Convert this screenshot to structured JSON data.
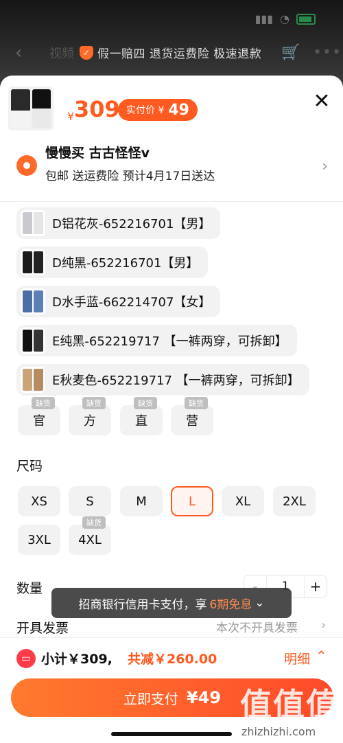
{
  "top_bar": {
    "back_icon": "chevron-left-icon",
    "tab_text": "视频",
    "guarantee": "假一赔四 退货运费险 极速退款",
    "shield_glyph": "✓",
    "cart_icon": "cart-icon",
    "more_icon": "more-icon"
  },
  "product": {
    "price_symbol": "¥",
    "price": "309",
    "pay_price_label": "实付价 ¥",
    "pay_price_value": "49",
    "close_glyph": "✕"
  },
  "shop": {
    "name": "慢慢买 古古怪怪v",
    "shipping_info": "包邮 送运费险 预计4月17日送达"
  },
  "variants": [
    {
      "label": "D铝花灰-652216701【男】",
      "c1": "#c9c9cf",
      "c2": "#e5e5e5"
    },
    {
      "label": "D纯黑-652216701【男】",
      "c1": "#1b1b1b",
      "c2": "#222"
    },
    {
      "label": "D水手蓝-662214707【女】",
      "c1": "#4a6fa5",
      "c2": "#5b7fb6"
    },
    {
      "label": "E纯黑-652219717 【一裤两穿，可拆卸】",
      "c1": "#111",
      "c2": "#333"
    },
    {
      "label": "E秋麦色-652219717 【一裤两穿，可拆卸】",
      "c1": "#c9a47b",
      "c2": "#b58b62"
    }
  ],
  "extra_chips": [
    {
      "label": "官",
      "badge": "缺货"
    },
    {
      "label": "方",
      "badge": "缺货"
    },
    {
      "label": "直",
      "badge": "缺货"
    },
    {
      "label": "营",
      "badge": "缺货"
    }
  ],
  "size": {
    "title": "尺码",
    "options": [
      {
        "label": "XS"
      },
      {
        "label": "S"
      },
      {
        "label": "M"
      },
      {
        "label": "L",
        "selected": true
      },
      {
        "label": "XL"
      },
      {
        "label": "2XL"
      },
      {
        "label": "3XL"
      },
      {
        "label": "4XL",
        "badge": "缺货"
      }
    ]
  },
  "quantity": {
    "title": "数量",
    "minus": "-",
    "value": "1",
    "plus": "+"
  },
  "toast": {
    "text": "招商银行信用卡支付，享",
    "highlight": "6期免息",
    "chevron": "⌄"
  },
  "invoice": {
    "label": "开具发票",
    "value": "本次不开具发票",
    "chevron": "›"
  },
  "summary": {
    "ticket_glyph": "▭",
    "subtotal": "小计￥309,",
    "reduction": "共减￥260.00",
    "detail": "明细",
    "up_glyph": "⌃"
  },
  "pay_button": {
    "label": "立即支付",
    "amount": "¥49"
  },
  "watermark": {
    "text": "值值值",
    "site": "zhizhizhi.com"
  },
  "colors": {
    "accent": "#ff5a1f",
    "badge_gray": "#bfbfbf"
  }
}
